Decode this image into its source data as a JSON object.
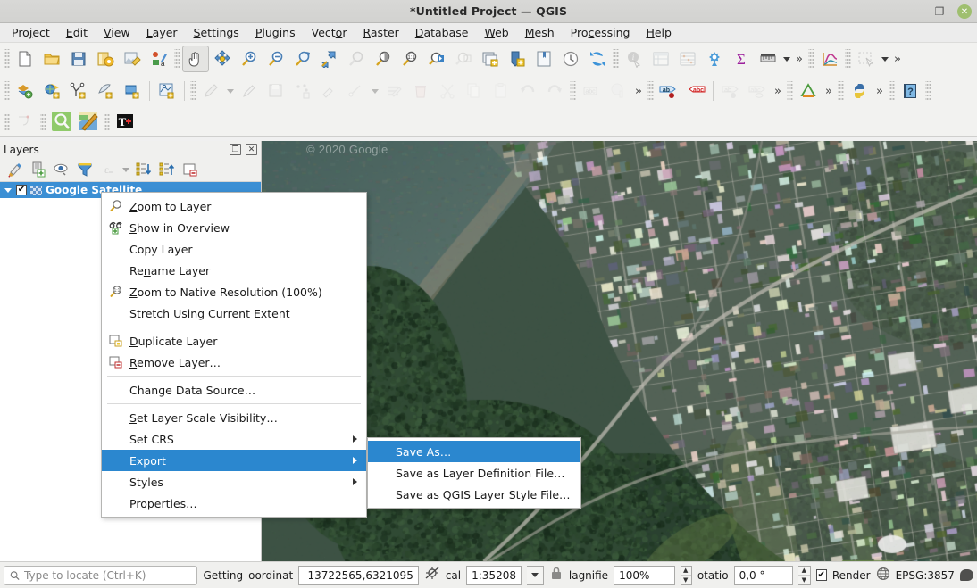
{
  "window": {
    "title": "*Untitled Project — QGIS",
    "minimize": "–",
    "restore": "❐",
    "close": "✕"
  },
  "menubar": [
    {
      "label": "Project",
      "mnemonic": "j"
    },
    {
      "label": "Edit",
      "mnemonic": "E"
    },
    {
      "label": "View",
      "mnemonic": "V"
    },
    {
      "label": "Layer",
      "mnemonic": "L"
    },
    {
      "label": "Settings",
      "mnemonic": "S"
    },
    {
      "label": "Plugins",
      "mnemonic": "P"
    },
    {
      "label": "Vector",
      "mnemonic": "o"
    },
    {
      "label": "Raster",
      "mnemonic": "R"
    },
    {
      "label": "Database",
      "mnemonic": "D"
    },
    {
      "label": "Web",
      "mnemonic": "W"
    },
    {
      "label": "Mesh",
      "mnemonic": "M"
    },
    {
      "label": "Processing",
      "mnemonic": "c"
    },
    {
      "label": "Help",
      "mnemonic": "H"
    }
  ],
  "toolbars": {
    "row1": [
      "new-project-icon",
      "open-project-icon",
      "save-project-icon",
      "save-project-as-icon",
      "new-print-layout-icon",
      "style-manager-icon",
      "pan-map-icon",
      "pan-to-selection-icon",
      "zoom-in-icon",
      "zoom-out-icon",
      "zoom-full-icon",
      "zoom-to-selection-icon",
      "zoom-to-layer-icon",
      "zoom-native-icon",
      "zoom-last-icon",
      "zoom-next-icon",
      "refresh-layer-icon",
      "new-map-view-icon",
      "new-3d-map-view-icon",
      "temporal-controller-icon",
      "refresh-icon",
      "identify-features-icon",
      "open-attribute-table-icon",
      "field-calculator-icon",
      "processing-toolbox-icon",
      "statistical-summary-icon",
      "measure-line-icon",
      "overflow-chevron-1",
      "data-plotly-icon",
      "select-features-icon",
      "overflow-chevron-2"
    ],
    "row2": [
      "add-vector-layer-icon",
      "add-raster-layer-icon",
      "add-delimited-text-icon",
      "add-mesh-layer-icon",
      "add-postgis-layer-icon",
      "add-vector-tile-icon",
      "edit-toggle-icon",
      "current-edits-icon",
      "save-layer-edits-icon",
      "add-feature-icon",
      "move-feature-icon",
      "node-tool-icon",
      "modify-attributes-icon",
      "delete-selected-icon",
      "cut-features-icon",
      "copy-features-icon",
      "paste-features-icon",
      "undo-icon",
      "redo-icon",
      "label-toolbar-icon",
      "diagram-icon",
      "show-labels-icon",
      "show-pinned-labels-icon",
      "label-dim-1",
      "label-dim-2",
      "overflow-chevron-3",
      "mesh-icon",
      "overflow-chevron-4",
      "python-console-icon",
      "overflow-chevron-5",
      "help-icon"
    ],
    "row3": [
      "measure-angle-icon",
      "metasearch-icon",
      "georeferencer-icon",
      "text-annotation-icon"
    ]
  },
  "layers_panel": {
    "title": "Layers",
    "float_button": "❐",
    "close_button": "✕",
    "toolbar_icons": [
      "open-layer-styling-icon",
      "add-group-icon",
      "manage-visibility-icon",
      "filter-legend-icon",
      "filter-legend-expression-icon",
      "expand-all-icon",
      "collapse-all-icon",
      "remove-layer-icon"
    ],
    "layers": [
      {
        "name": "Google Satellite",
        "checked": true,
        "check_glyph": "✔",
        "expanded": true
      }
    ]
  },
  "map": {
    "watermark": "© 2020 Google"
  },
  "context_menu": {
    "items": [
      {
        "id": "zoom-to-layer",
        "label": "Zoom to Layer",
        "mnemonic": "Z",
        "icon": "zoom-layer-icon",
        "type": "item"
      },
      {
        "id": "show-in-overview",
        "label": "Show in Overview",
        "mnemonic": "S",
        "icon": "overview-icon",
        "type": "item"
      },
      {
        "id": "copy-layer",
        "label": "Copy Layer",
        "mnemonic": "",
        "icon": "",
        "type": "item"
      },
      {
        "id": "rename-layer",
        "label": "Rename Layer",
        "mnemonic": "n",
        "icon": "",
        "type": "item"
      },
      {
        "id": "zoom-native-resolution",
        "label": "Zoom to Native Resolution (100%)",
        "mnemonic": "Z",
        "icon": "zoom-native-icon",
        "type": "item"
      },
      {
        "id": "stretch-current-extent",
        "label": "Stretch Using Current Extent",
        "mnemonic": "S",
        "icon": "",
        "type": "item"
      },
      {
        "id": "sep1",
        "type": "separator"
      },
      {
        "id": "duplicate-layer",
        "label": "Duplicate Layer",
        "mnemonic": "D",
        "icon": "duplicate-layer-icon",
        "type": "item"
      },
      {
        "id": "remove-layer",
        "label": "Remove Layer…",
        "mnemonic": "R",
        "icon": "remove-layer-icon",
        "type": "item"
      },
      {
        "id": "sep2",
        "type": "separator"
      },
      {
        "id": "change-data-source",
        "label": "Change Data Source…",
        "mnemonic": "",
        "icon": "",
        "type": "item"
      },
      {
        "id": "sep3",
        "type": "separator"
      },
      {
        "id": "set-layer-scale-visibility",
        "label": "Set Layer Scale Visibility…",
        "mnemonic": "S",
        "icon": "",
        "type": "item"
      },
      {
        "id": "set-crs",
        "label": "Set CRS",
        "mnemonic": "",
        "icon": "",
        "type": "submenu"
      },
      {
        "id": "export",
        "label": "Export",
        "mnemonic": "",
        "icon": "",
        "type": "submenu",
        "selected": true
      },
      {
        "id": "styles",
        "label": "Styles",
        "mnemonic": "",
        "icon": "",
        "type": "submenu"
      },
      {
        "id": "properties",
        "label": "Properties…",
        "mnemonic": "P",
        "icon": "",
        "type": "item"
      }
    ]
  },
  "export_submenu": {
    "items": [
      {
        "id": "save-as",
        "label": "Save As…",
        "selected": true
      },
      {
        "id": "save-as-layer-definition",
        "label": "Save as Layer Definition File…",
        "selected": false
      },
      {
        "id": "save-as-qgis-style",
        "label": "Save as QGIS Layer Style File…",
        "selected": false
      }
    ]
  },
  "statusbar": {
    "locate_placeholder": "Type to locate (Ctrl+K)",
    "locate_value": "",
    "getting_label": "Getting",
    "coordinate_label": "oordinat",
    "coordinate_value": "-13722565,6321095",
    "toggle_extents_icon": "toggle-extents-icon",
    "scale_label": "cal",
    "scale_value": "1:35208",
    "lock_icon": "lock-scale-icon",
    "magnifier_label": "lagnifie",
    "magnifier_value": "100%",
    "rotation_label": "otatio",
    "rotation_value": "0,0 °",
    "render_label": "Render",
    "render_checked": true,
    "render_glyph": "✔",
    "crs_label": "EPSG:3857",
    "crs_icon": "globe-icon",
    "messages_icon": "messages-icon"
  }
}
